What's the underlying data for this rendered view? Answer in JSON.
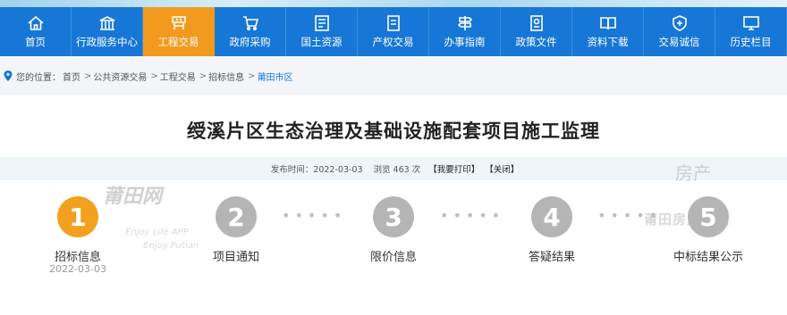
{
  "nav": {
    "items": [
      {
        "label": "首页",
        "icon": "home-icon"
      },
      {
        "label": "行政服务中心",
        "icon": "building-icon"
      },
      {
        "label": "工程交易",
        "icon": "construction-icon",
        "active": true
      },
      {
        "label": "政府采购",
        "icon": "cart-icon"
      },
      {
        "label": "国土资源",
        "icon": "land-icon"
      },
      {
        "label": "产权交易",
        "icon": "document-icon"
      },
      {
        "label": "办事指南",
        "icon": "signpost-icon"
      },
      {
        "label": "政策文件",
        "icon": "policy-icon"
      },
      {
        "label": "资料下载",
        "icon": "book-icon"
      },
      {
        "label": "交易诚信",
        "icon": "shield-icon"
      },
      {
        "label": "历史栏目",
        "icon": "monitor-icon"
      }
    ],
    "active_color": "#f29a1e",
    "bar_color": "#1677d6"
  },
  "breadcrumb": {
    "prefix": "您的位置：",
    "items": [
      "首页",
      "公共资源交易",
      "工程交易",
      "招标信息",
      "莆田市区"
    ],
    "separator": ">"
  },
  "article": {
    "title": "绶溪片区生态治理及基础设施配套项目施工监理",
    "publish_label": "发布时间：",
    "publish_date": "2022-03-03",
    "views_label": "浏览",
    "views_count": "463",
    "views_unit": "次",
    "print_action": "【我要打印】",
    "close_action": "【关闭】"
  },
  "steps": [
    {
      "number": "1",
      "label": "招标信息",
      "date": "2022-03-03",
      "active": true
    },
    {
      "number": "2",
      "label": "项目通知",
      "date": ""
    },
    {
      "number": "3",
      "label": "限价信息",
      "date": ""
    },
    {
      "number": "4",
      "label": "答疑结果",
      "date": ""
    },
    {
      "number": "5",
      "label": "中标结果公示",
      "date": ""
    }
  ],
  "watermarks": {
    "left_main": "莆田网",
    "left_sub1": "Enjoy Life  APP",
    "left_sub2": "Enjoy Putian",
    "right_main": "房产",
    "right_sub": "莆田房产情报"
  }
}
